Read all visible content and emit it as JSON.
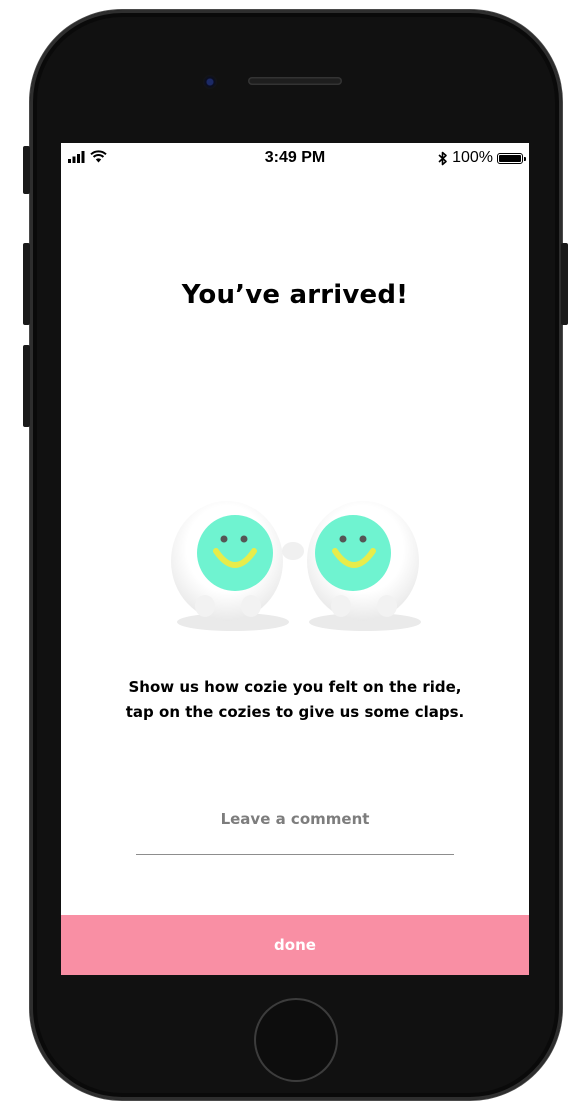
{
  "status_bar": {
    "time": "3:49 PM",
    "battery_text": "100%",
    "signal_icon": "cellular-signal-icon",
    "wifi_icon": "wifi-icon",
    "bluetooth_icon": "bluetooth-icon",
    "battery_icon": "battery-icon",
    "battery_level": 1.0
  },
  "screen": {
    "title": "You’ve arrived!",
    "message": "Show us how cozie you felt on the ride, tap on the cozies to give us some claps.",
    "comment": {
      "placeholder": "Leave a comment",
      "value": ""
    },
    "done_label": "done",
    "cozies": [
      {
        "icon": "cozie-smiley-icon"
      },
      {
        "icon": "cozie-smiley-icon"
      }
    ]
  },
  "colors": {
    "accent": "#f98fa4",
    "cozie_face": "#6ff3d0",
    "cozie_smile": "#e8ec4a",
    "placeholder": "#7d7d7d"
  }
}
